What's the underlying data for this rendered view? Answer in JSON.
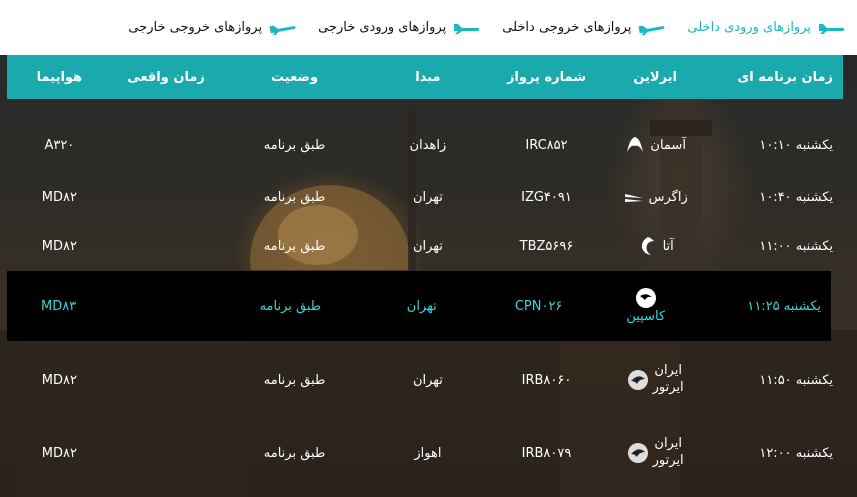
{
  "tabs": [
    {
      "label": "پروازهای ورودی داخلی",
      "active": true
    },
    {
      "label": "پروازهای خروجی داخلی",
      "active": false
    },
    {
      "label": "پروازهای ورودی خارجی",
      "active": false
    },
    {
      "label": "پروازهای خروجی خارجی",
      "active": false
    }
  ],
  "columns": {
    "time": "زمان برنامه ای",
    "airline": "ایرلاین",
    "flight": "شماره پرواز",
    "origin": "مبدا",
    "status": "وضعیت",
    "actual": "زمان واقعی",
    "aircraft": "هواپیما"
  },
  "rows": [
    {
      "time": "یکشنبه ۱۰:۱۰",
      "airline": "آسمان",
      "airline2": "",
      "flight": "IRC۸۵۲",
      "origin": "زاهدان",
      "status": "طبق برنامه",
      "actual": "",
      "aircraft": "A۳۲۰",
      "logo": "aseman-logo"
    },
    {
      "time": "یکشنبه ۱۰:۴۰",
      "airline": "زاگرس",
      "airline2": "",
      "flight": "IZG۴۰۹۱",
      "origin": "تهران",
      "status": "طبق برنامه",
      "actual": "",
      "aircraft": "MD۸۲",
      "logo": "zagros-logo"
    },
    {
      "time": "یکشنبه ۱۱:۰۰",
      "airline": "آتا",
      "airline2": "",
      "flight": "TBZ۵۶۹۶",
      "origin": "تهران",
      "status": "طبق برنامه",
      "actual": "",
      "aircraft": "MD۸۲",
      "logo": "ata-logo"
    },
    {
      "time": "یکشنبه ۱۱:۲۵",
      "airline": "کاسپین",
      "airline2": "",
      "flight": "CPN۰۲۶",
      "origin": "تهران",
      "status": "طبق برنامه",
      "actual": "",
      "aircraft": "MD۸۳",
      "logo": "caspian-logo",
      "highlight": true
    },
    {
      "time": "یکشنبه ۱۱:۵۰",
      "airline": "ایران",
      "airline2": "ایرتور",
      "flight": "IRB۸۰۶۰",
      "origin": "تهران",
      "status": "طبق برنامه",
      "actual": "",
      "aircraft": "MD۸۲",
      "logo": "iran-airtour-logo"
    },
    {
      "time": "یکشنبه ۱۲:۰۰",
      "airline": "ایران",
      "airline2": "ایرتور",
      "flight": "IRB۸۰۷۹",
      "origin": "اهواز",
      "status": "طبق برنامه",
      "actual": "",
      "aircraft": "MD۸۲",
      "logo": "iran-airtour-logo"
    }
  ],
  "colors": {
    "accent": "#1aa9ad",
    "active_tab": "#1ab9bf",
    "highlight_text": "#3fd3d8"
  }
}
